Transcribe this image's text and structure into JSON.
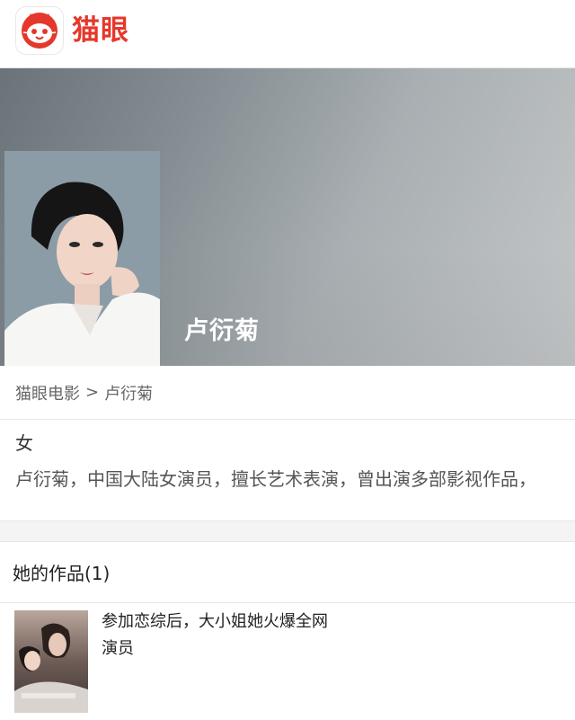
{
  "header": {
    "logo_icon": "cat-logo-icon",
    "brand_name": "猫眼",
    "brand_color": "#e5372b"
  },
  "banner": {
    "actor_name": "卢衍菊"
  },
  "breadcrumb": {
    "root": "猫眼电影",
    "separator": ">",
    "current": "卢衍菊"
  },
  "info": {
    "gender": "女",
    "bio": "卢衍菊，中国大陆女演员，擅长艺术表演，曾出演多部影视作品，"
  },
  "works": {
    "heading": "她的作品(1)",
    "items": [
      {
        "title": "参加恋综后，大小姐她火爆全网",
        "role": "演员"
      }
    ]
  }
}
